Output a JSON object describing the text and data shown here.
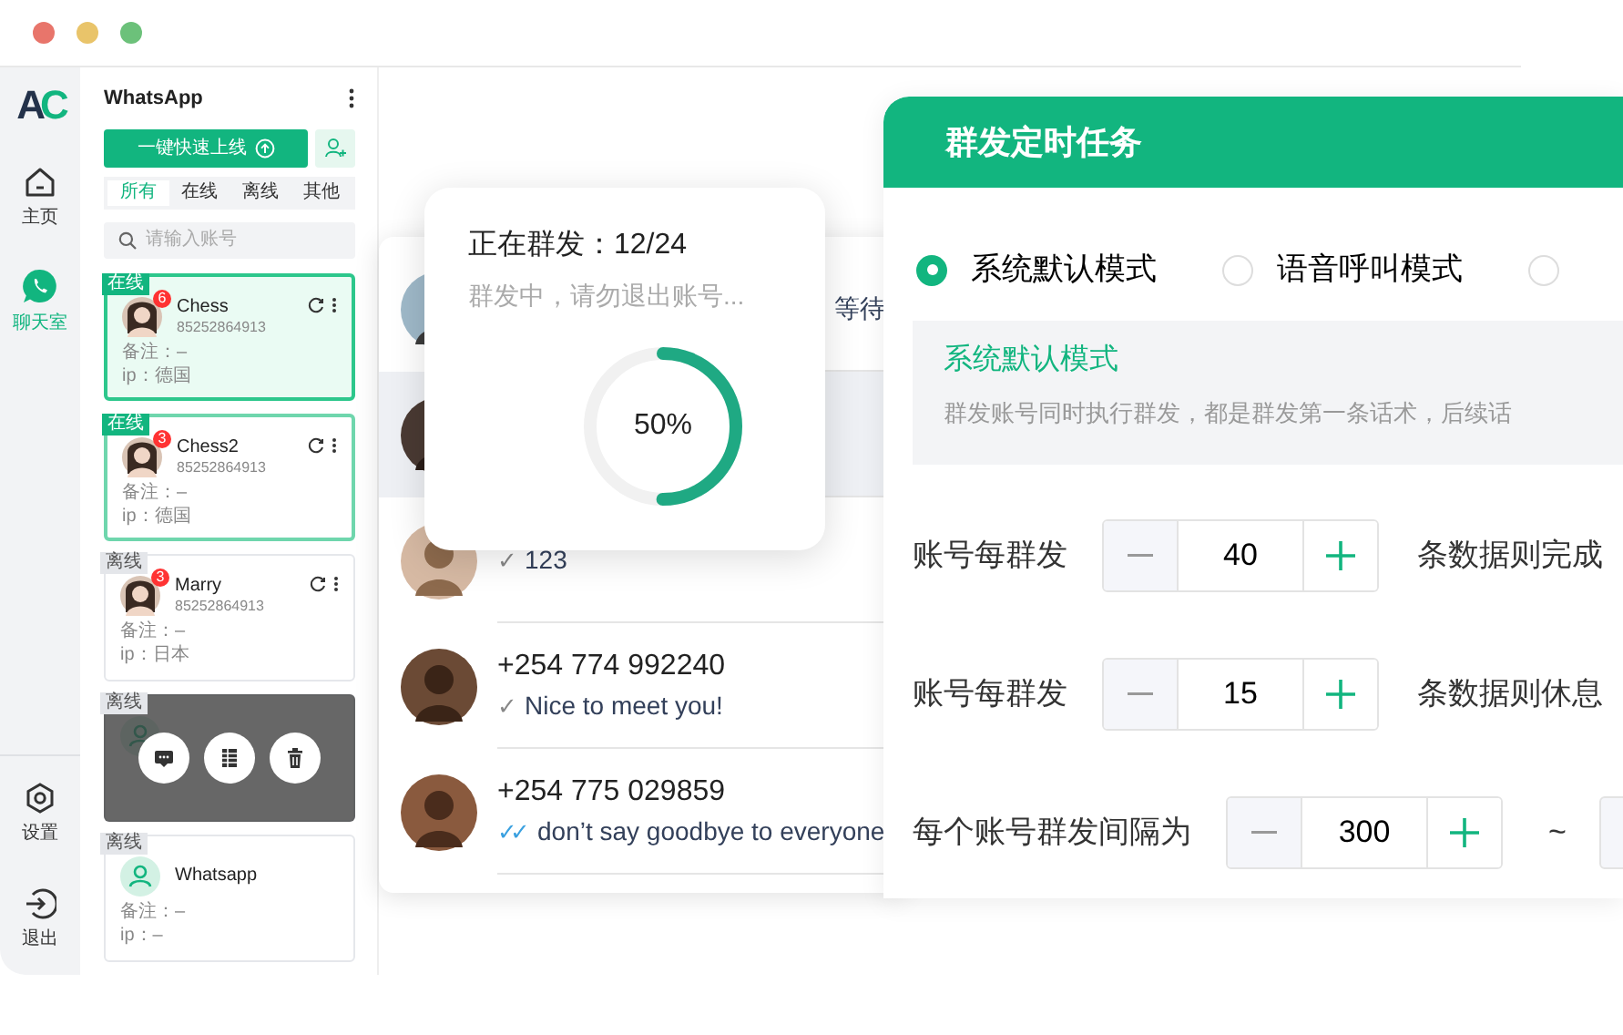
{
  "logo": "AC",
  "rail": {
    "items": [
      {
        "label": "主页",
        "kind": "home",
        "selected": false
      },
      {
        "label": "聊天室",
        "kind": "chat",
        "selected": true
      }
    ],
    "bottom_items": [
      {
        "label": "设置",
        "kind": "settings"
      },
      {
        "label": "退出",
        "kind": "logout"
      }
    ]
  },
  "accounts": {
    "title": "WhatsApp",
    "online_button": "一键快速上线",
    "filters": [
      {
        "label": "所有",
        "selected": true
      },
      {
        "label": "在线",
        "selected": false
      },
      {
        "label": "离线",
        "selected": false
      },
      {
        "label": "其他",
        "selected": false
      }
    ],
    "search": {
      "placeholder": "请输入账号"
    },
    "cards": [
      {
        "status": "在线",
        "online": true,
        "selected": true,
        "hovered": false,
        "kind": "photo",
        "unread": "6",
        "name": "Chess",
        "phone": "85252864913",
        "note": "备注：–",
        "ip": "ip：德国"
      },
      {
        "status": "在线",
        "online": true,
        "selected": false,
        "hovered": false,
        "kind": "photo",
        "unread": "3",
        "name": "Chess2",
        "phone": "85252864913",
        "note": "备注：–",
        "ip": "ip：德国"
      },
      {
        "status": "离线",
        "online": false,
        "selected": false,
        "hovered": false,
        "kind": "photo",
        "unread": "3",
        "name": "Marry",
        "phone": "85252864913",
        "note": "备注：–",
        "ip": "ip：日本"
      },
      {
        "status": "离线",
        "online": false,
        "selected": false,
        "hovered": true,
        "kind": "default",
        "actions": [
          {
            "kind": "message"
          },
          {
            "kind": "list"
          },
          {
            "kind": "delete"
          }
        ]
      },
      {
        "status": "离线",
        "online": false,
        "selected": false,
        "hovered": false,
        "kind": "default",
        "name": "Whatsapp",
        "note": "备注：–",
        "ip": "ip：–"
      }
    ]
  },
  "chats": [
    {
      "kind": "clipped",
      "selected": false,
      "message": "等待"
    },
    {
      "kind": "normal",
      "selected": true
    },
    {
      "kind": "normal",
      "selected": false,
      "message": "123",
      "tick": "✓",
      "read": false
    },
    {
      "kind": "normal",
      "selected": false,
      "name": "+254 774 992240",
      "message": "Nice to meet you!",
      "tick": "✓",
      "read": false
    },
    {
      "kind": "normal",
      "selected": false,
      "name": "+254 775 029859",
      "message": "don’t say goodbye to everyone",
      "tick": "✓✓",
      "read": true
    }
  ],
  "progress": {
    "title": "正在群发：12/24",
    "subtitle": "群发中，请勿退出账号...",
    "percent": "50%"
  },
  "settings": {
    "title": "群发定时任务",
    "modes": [
      {
        "label": "系统默认模式",
        "selected": true
      },
      {
        "label": "语音呼叫模式",
        "selected": false
      },
      {
        "selected": false
      }
    ],
    "info": {
      "title": "系统默认模式",
      "text": "群发账号同时执行群发，都是群发第一条话术，后续话"
    },
    "rows": [
      {
        "label": "账号每群发",
        "value": "40",
        "suffix": "条数据则完成"
      },
      {
        "label": "账号每群发",
        "value": "15",
        "suffix": "条数据则休息"
      },
      {
        "label": "每个账号群发间隔为",
        "value": "300",
        "separator": "~"
      }
    ]
  }
}
